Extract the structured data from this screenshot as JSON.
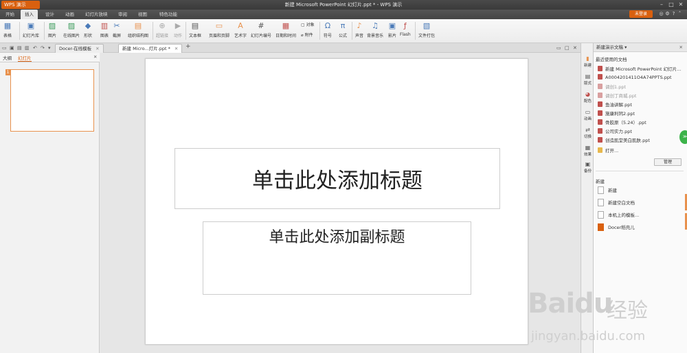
{
  "app": {
    "button_label": "WPS 演示",
    "window_title": "新建 Microsoft PowerPoint 幻灯片.ppt * - WPS 演示"
  },
  "menu": {
    "items": [
      "开始",
      "插入",
      "设计",
      "动画",
      "幻灯片放映",
      "审阅",
      "视图",
      "特色功能"
    ],
    "active_index": 1,
    "login_label": "未登录"
  },
  "ribbon": {
    "items": [
      {
        "label": "表格",
        "icon": "table-icon"
      },
      {
        "label": "幻灯片库",
        "icon": "slide-library-icon"
      },
      {
        "label": "图片",
        "icon": "picture-icon"
      },
      {
        "label": "在线图片",
        "icon": "online-picture-icon"
      },
      {
        "label": "形状",
        "icon": "shape-icon"
      },
      {
        "label": "图表",
        "icon": "chart-icon"
      },
      {
        "label": "截屏",
        "icon": "screenshot-icon"
      },
      {
        "label": "组织结构图",
        "icon": "org-chart-icon"
      },
      {
        "label": "超链接",
        "icon": "hyperlink-icon"
      },
      {
        "label": "动作",
        "icon": "action-icon"
      },
      {
        "label": "文本框",
        "icon": "textbox-icon"
      },
      {
        "label": "页眉和页脚",
        "icon": "header-footer-icon"
      },
      {
        "label": "艺术字",
        "icon": "wordart-icon"
      },
      {
        "label": "幻灯片编号",
        "icon": "slide-number-icon"
      },
      {
        "label": "日期和时间",
        "icon": "datetime-icon"
      },
      {
        "label": "对象",
        "icon": "object-icon"
      },
      {
        "label": "附件",
        "icon": "attachment-icon"
      },
      {
        "label": "符号",
        "icon": "symbol-icon"
      },
      {
        "label": "公式",
        "icon": "formula-icon"
      },
      {
        "label": "声音",
        "icon": "sound-icon"
      },
      {
        "label": "背景音乐",
        "icon": "music-icon"
      },
      {
        "label": "影片",
        "icon": "movie-icon"
      },
      {
        "label": "Flash",
        "icon": "flash-icon"
      },
      {
        "label": "文件打包",
        "icon": "package-icon"
      }
    ]
  },
  "tabs": [
    {
      "label": "Docer-在线模板"
    },
    {
      "label": "新建 Micro...灯片.ppt *"
    }
  ],
  "left_panel": {
    "tabs": [
      "大纲",
      "幻灯片"
    ],
    "slide_number": "1"
  },
  "slide": {
    "title_placeholder": "单击此处添加标题",
    "subtitle_placeholder": "单击此处添加副标题"
  },
  "side_strip": [
    "新建",
    "版式",
    "配色",
    "动画",
    "切换",
    "效果",
    "备份"
  ],
  "task_pane": {
    "header": "新建演示文稿",
    "recent_heading": "最近使用的文档",
    "recent_items": [
      {
        "label": "新建 Microsoft PowerPoint 幻灯片...",
        "dimmed": false
      },
      {
        "label": "A0004201411O4A74PPTS.ppt",
        "dimmed": false
      },
      {
        "label": "调创1.ppt",
        "dimmed": true
      },
      {
        "label": "调创丁商城.ppt",
        "dimmed": true
      },
      {
        "label": "鱼油讲解.ppt",
        "dimmed": false
      },
      {
        "label": "施康利钙2.ppt",
        "dimmed": false
      },
      {
        "label": "骨胶原（5.24）.ppt",
        "dimmed": false
      },
      {
        "label": "公司实力.ppt",
        "dimmed": false
      },
      {
        "label": "创造肌堂美白肌肤.ppt",
        "dimmed": false
      }
    ],
    "open_label": "打开...",
    "manage_label": "管理",
    "new_heading": "新建",
    "new_items": [
      {
        "label": "新建",
        "docer": false
      },
      {
        "label": "新建空白文档",
        "docer": false
      },
      {
        "label": "本机上的模板...",
        "docer": false
      },
      {
        "label": "Docer稻壳儿",
        "docer": true
      }
    ]
  },
  "watermark": {
    "logo": "Baidu",
    "cn": "经验",
    "url": "jingyan.baidu.com"
  }
}
